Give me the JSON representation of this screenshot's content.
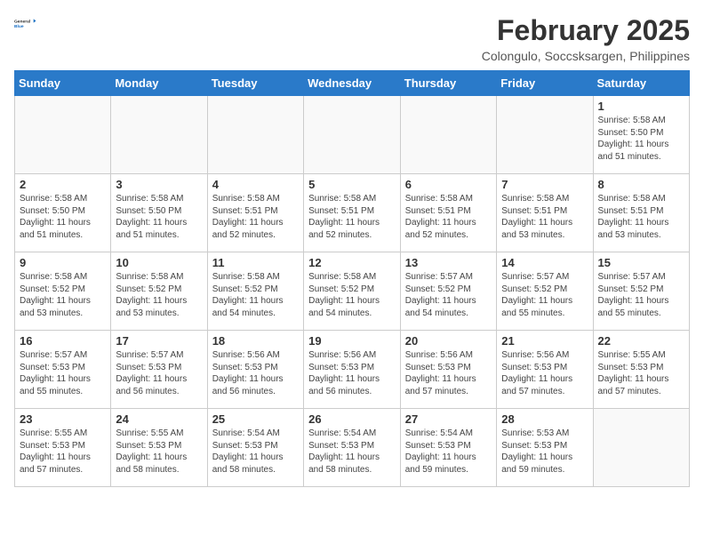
{
  "header": {
    "logo_general": "General",
    "logo_blue": "Blue",
    "month_year": "February 2025",
    "location": "Colongulo, Soccsksargen, Philippines"
  },
  "weekdays": [
    "Sunday",
    "Monday",
    "Tuesday",
    "Wednesday",
    "Thursday",
    "Friday",
    "Saturday"
  ],
  "weeks": [
    [
      {
        "day": "",
        "info": ""
      },
      {
        "day": "",
        "info": ""
      },
      {
        "day": "",
        "info": ""
      },
      {
        "day": "",
        "info": ""
      },
      {
        "day": "",
        "info": ""
      },
      {
        "day": "",
        "info": ""
      },
      {
        "day": "1",
        "info": "Sunrise: 5:58 AM\nSunset: 5:50 PM\nDaylight: 11 hours\nand 51 minutes."
      }
    ],
    [
      {
        "day": "2",
        "info": "Sunrise: 5:58 AM\nSunset: 5:50 PM\nDaylight: 11 hours\nand 51 minutes."
      },
      {
        "day": "3",
        "info": "Sunrise: 5:58 AM\nSunset: 5:50 PM\nDaylight: 11 hours\nand 51 minutes."
      },
      {
        "day": "4",
        "info": "Sunrise: 5:58 AM\nSunset: 5:51 PM\nDaylight: 11 hours\nand 52 minutes."
      },
      {
        "day": "5",
        "info": "Sunrise: 5:58 AM\nSunset: 5:51 PM\nDaylight: 11 hours\nand 52 minutes."
      },
      {
        "day": "6",
        "info": "Sunrise: 5:58 AM\nSunset: 5:51 PM\nDaylight: 11 hours\nand 52 minutes."
      },
      {
        "day": "7",
        "info": "Sunrise: 5:58 AM\nSunset: 5:51 PM\nDaylight: 11 hours\nand 53 minutes."
      },
      {
        "day": "8",
        "info": "Sunrise: 5:58 AM\nSunset: 5:51 PM\nDaylight: 11 hours\nand 53 minutes."
      }
    ],
    [
      {
        "day": "9",
        "info": "Sunrise: 5:58 AM\nSunset: 5:52 PM\nDaylight: 11 hours\nand 53 minutes."
      },
      {
        "day": "10",
        "info": "Sunrise: 5:58 AM\nSunset: 5:52 PM\nDaylight: 11 hours\nand 53 minutes."
      },
      {
        "day": "11",
        "info": "Sunrise: 5:58 AM\nSunset: 5:52 PM\nDaylight: 11 hours\nand 54 minutes."
      },
      {
        "day": "12",
        "info": "Sunrise: 5:58 AM\nSunset: 5:52 PM\nDaylight: 11 hours\nand 54 minutes."
      },
      {
        "day": "13",
        "info": "Sunrise: 5:57 AM\nSunset: 5:52 PM\nDaylight: 11 hours\nand 54 minutes."
      },
      {
        "day": "14",
        "info": "Sunrise: 5:57 AM\nSunset: 5:52 PM\nDaylight: 11 hours\nand 55 minutes."
      },
      {
        "day": "15",
        "info": "Sunrise: 5:57 AM\nSunset: 5:52 PM\nDaylight: 11 hours\nand 55 minutes."
      }
    ],
    [
      {
        "day": "16",
        "info": "Sunrise: 5:57 AM\nSunset: 5:53 PM\nDaylight: 11 hours\nand 55 minutes."
      },
      {
        "day": "17",
        "info": "Sunrise: 5:57 AM\nSunset: 5:53 PM\nDaylight: 11 hours\nand 56 minutes."
      },
      {
        "day": "18",
        "info": "Sunrise: 5:56 AM\nSunset: 5:53 PM\nDaylight: 11 hours\nand 56 minutes."
      },
      {
        "day": "19",
        "info": "Sunrise: 5:56 AM\nSunset: 5:53 PM\nDaylight: 11 hours\nand 56 minutes."
      },
      {
        "day": "20",
        "info": "Sunrise: 5:56 AM\nSunset: 5:53 PM\nDaylight: 11 hours\nand 57 minutes."
      },
      {
        "day": "21",
        "info": "Sunrise: 5:56 AM\nSunset: 5:53 PM\nDaylight: 11 hours\nand 57 minutes."
      },
      {
        "day": "22",
        "info": "Sunrise: 5:55 AM\nSunset: 5:53 PM\nDaylight: 11 hours\nand 57 minutes."
      }
    ],
    [
      {
        "day": "23",
        "info": "Sunrise: 5:55 AM\nSunset: 5:53 PM\nDaylight: 11 hours\nand 57 minutes."
      },
      {
        "day": "24",
        "info": "Sunrise: 5:55 AM\nSunset: 5:53 PM\nDaylight: 11 hours\nand 58 minutes."
      },
      {
        "day": "25",
        "info": "Sunrise: 5:54 AM\nSunset: 5:53 PM\nDaylight: 11 hours\nand 58 minutes."
      },
      {
        "day": "26",
        "info": "Sunrise: 5:54 AM\nSunset: 5:53 PM\nDaylight: 11 hours\nand 58 minutes."
      },
      {
        "day": "27",
        "info": "Sunrise: 5:54 AM\nSunset: 5:53 PM\nDaylight: 11 hours\nand 59 minutes."
      },
      {
        "day": "28",
        "info": "Sunrise: 5:53 AM\nSunset: 5:53 PM\nDaylight: 11 hours\nand 59 minutes."
      },
      {
        "day": "",
        "info": ""
      }
    ]
  ]
}
